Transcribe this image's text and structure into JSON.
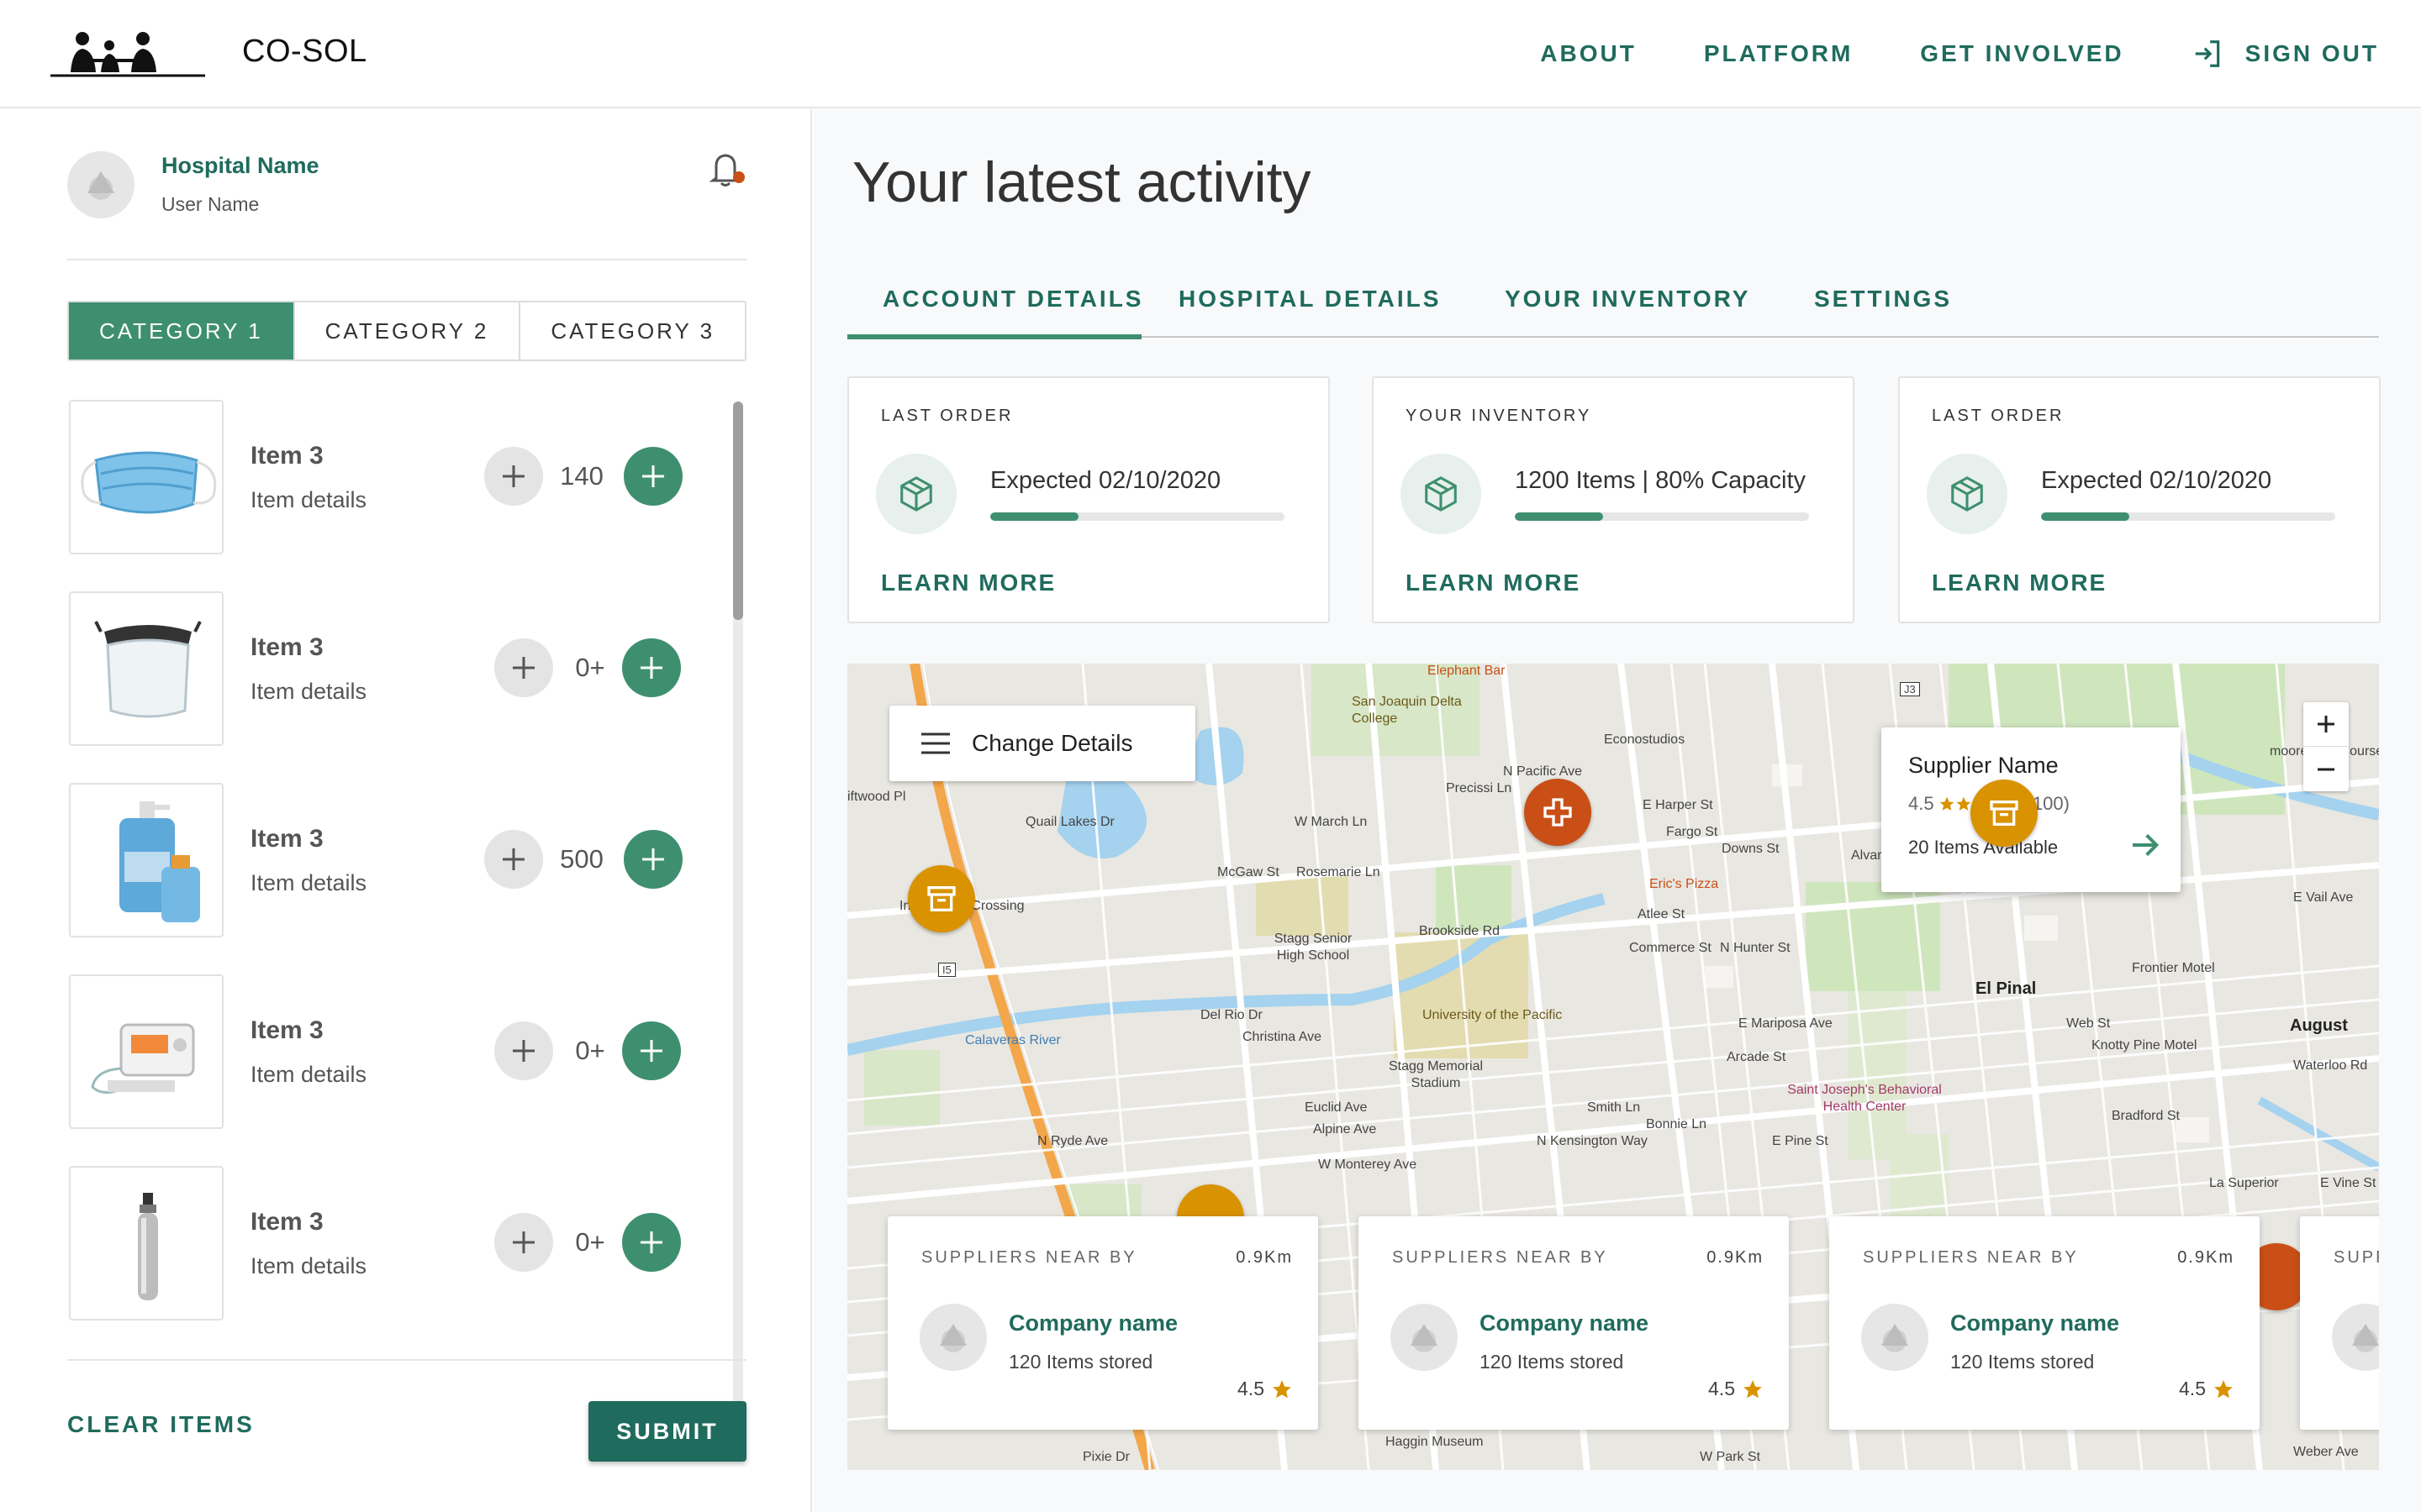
{
  "header": {
    "brand": "CO-SOL",
    "nav": [
      "ABOUT",
      "PLATFORM",
      "GET INVOLVED"
    ],
    "sign_out": "SIGN OUT"
  },
  "sidebar": {
    "hospital_name": "Hospital Name",
    "user_name": "User Name",
    "categories": [
      "CATEGORY 1",
      "CATEGORY 2",
      "CATEGORY 3"
    ],
    "active_category": "CATEGORY 1",
    "items": [
      {
        "title": "Item 3",
        "details": "Item details",
        "qty": "140",
        "image": "face-mask-image"
      },
      {
        "title": "Item 3",
        "details": "Item details",
        "qty": "0+",
        "image": "face-shield-image"
      },
      {
        "title": "Item 3",
        "details": "Item details",
        "qty": "500",
        "image": "hand-sanitizer-image"
      },
      {
        "title": "Item 3",
        "details": "Item details",
        "qty": "0+",
        "image": "ventilator-image"
      },
      {
        "title": "Item 3",
        "details": "Item details",
        "qty": "0+",
        "image": "oxygen-cylinder-image"
      }
    ],
    "clear_label": "CLEAR ITEMS",
    "submit_label": "SUBMIT"
  },
  "main": {
    "title": "Your latest activity",
    "tabs": [
      "ACCOUNT DETAILS",
      "HOSPITAL DETAILS",
      "YOUR INVENTORY",
      "SETTINGS"
    ],
    "active_tab": "ACCOUNT DETAILS",
    "cards": [
      {
        "label": "LAST ORDER",
        "value": "Expected 02/10/2020",
        "progress": 0.3,
        "link": "LEARN MORE",
        "icon": "package-icon"
      },
      {
        "label": "YOUR INVENTORY",
        "value": "1200 Items | 80% Capacity",
        "progress": 0.3,
        "link": "LEARN MORE",
        "icon": "package-icon"
      },
      {
        "label": "LAST ORDER",
        "value": "Expected 02/10/2020",
        "progress": 0.3,
        "link": "LEARN MORE",
        "icon": "package-icon"
      }
    ]
  },
  "map": {
    "change_details": "Change Details",
    "supplier_popup": {
      "name": "Supplier Name",
      "rating": "4.5",
      "stars_filled": 4,
      "reviews": "(100)",
      "items": "20 Items Available"
    },
    "near_cards": [
      {
        "label": "SUPPLIERS NEAR BY",
        "distance": "0.9Km",
        "name": "Company name",
        "stored": "120 Items stored",
        "rating": "4.5"
      },
      {
        "label": "SUPPLIERS NEAR BY",
        "distance": "0.9Km",
        "name": "Company name",
        "stored": "120 Items stored",
        "rating": "4.5"
      },
      {
        "label": "SUPPLIERS NEAR BY",
        "distance": "0.9Km",
        "name": "Company name",
        "stored": "120 Items stored",
        "rating": "4.5"
      },
      {
        "label": "SUPPLIERS NEAR BY",
        "distance": "",
        "name": "",
        "stored": "",
        "rating": ""
      }
    ],
    "labels": [
      "Elephant Bar",
      "San Joaquin Delta College",
      "Econostudios",
      "E Harper St",
      "Fargo St",
      "Downs St",
      "Eric's Pizza",
      "Rosemarie Ln",
      "W March Ln",
      "Stagg Senior High School",
      "Brookside Rd",
      "Inn at Palm Crossing",
      "University of the Pacific",
      "Stagg Memorial Stadium",
      "Christina Ave",
      "Del Rio Dr",
      "Euclid Ave",
      "Alpine Ave",
      "W Monterey Ave",
      "E Mariposa Ave",
      "Arcade St",
      "Saint Joseph's Behavioral Health Center",
      "E Pine St",
      "El Pinal",
      "Frontier Motel",
      "Knotty Pine Motel",
      "August",
      "Waterloo Rd",
      "Bradford St",
      "La Superior",
      "E Vine St",
      "moore Golf Course",
      "E Vail Ave",
      "Smith Ln",
      "Quail Lakes Dr",
      "Precissi Ln",
      "N Pacific Ave",
      "Alvarado Ave",
      "Commerce St",
      "N Hunter St",
      "Atlee St",
      "McGaw St",
      "N Ryde Ave",
      "N Kensington Way",
      "Bonnie Ln",
      "Calaveras River",
      "Web St",
      "W Park St",
      "Pixie Dr",
      "Haggin Museum",
      "Weber Ave",
      "I5",
      "J3",
      "iftwood Pl"
    ],
    "colors": {
      "accent": "#3e8f70",
      "dark_accent": "#1f6b5d",
      "pin_hospital": "#c94f16",
      "pin_supplier": "#d99200"
    }
  }
}
